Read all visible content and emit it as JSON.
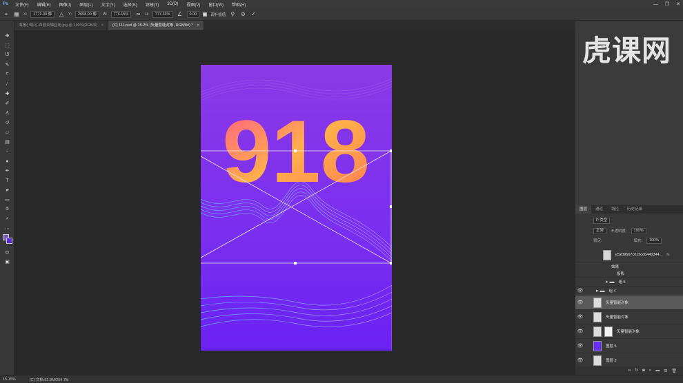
{
  "app": {
    "logo": "Ps"
  },
  "menu": [
    "文件(F)",
    "编辑(E)",
    "图像(I)",
    "图层(L)",
    "文字(Y)",
    "选择(S)",
    "滤镜(T)",
    "3D(D)",
    "视图(V)",
    "窗口(W)",
    "帮助(H)"
  ],
  "window_controls": [
    "—",
    "❐",
    "✕"
  ],
  "options": {
    "x_label": "X:",
    "x_value": "1771.00 像",
    "y_label": "Y:",
    "y_value": "2658.00 像",
    "w_label": "W:",
    "w_value": "776.15%",
    "h_label": "H:",
    "h_value": "777.33%",
    "angle_value": "0.00",
    "interp_label": "调补插值",
    "cancel_icon": "cancel-transform-icon",
    "commit_icon": "commit-transform-icon"
  },
  "tabs": [
    {
      "label": "海报小练习-AI混合轴应用.jpg @ 100%(RGB/8)",
      "close": "×",
      "active": false
    },
    {
      "label": "(C) 111.psd @ 15.2% (矢量智能对象, RGB/8#) *",
      "close": "×",
      "active": true
    }
  ],
  "watermark": "虎课网",
  "artwork": {
    "headline": "918"
  },
  "panels": {
    "tabs": [
      "图层",
      "通道",
      "路径",
      "历史记录"
    ],
    "kind_placeholder": "P 类型",
    "blend_mode": "正常",
    "opacity_label": "不透明度:",
    "opacity_value": "100%",
    "lock_label": "锁定:",
    "fill_label": "填充:",
    "fill_value": "100%",
    "layers": [
      {
        "name": "e52d9567c015cdb440344...",
        "fx": "fx",
        "visible": false,
        "selected": false,
        "thumb": "#d8d8d8"
      },
      {
        "name": "效果",
        "visible": false,
        "selected": false,
        "thumb": ""
      },
      {
        "name": "投影",
        "visible": false,
        "selected": false,
        "thumb": ""
      },
      {
        "name": "组 5",
        "visible": false,
        "selected": false,
        "thumb": "folder"
      },
      {
        "name": "组 4",
        "visible": true,
        "selected": false,
        "thumb": "folder"
      },
      {
        "name": "矢量智能对象",
        "visible": true,
        "selected": true,
        "thumb": "#dcdcdc"
      },
      {
        "name": "矢量智能对象",
        "visible": true,
        "selected": false,
        "thumb": "#dcdcdc"
      },
      {
        "name": "矢量智能对象",
        "visible": true,
        "selected": false,
        "thumb": "#dcdcdc"
      },
      {
        "name": "图层 5",
        "visible": true,
        "selected": false,
        "thumb": "#6a2cff"
      },
      {
        "name": "图层 2",
        "visible": true,
        "selected": false,
        "thumb": "#dcdcdc"
      }
    ]
  },
  "status": {
    "zoom": "15.15%",
    "doc_info": "(C) 文档:53.9M/254.7M"
  }
}
